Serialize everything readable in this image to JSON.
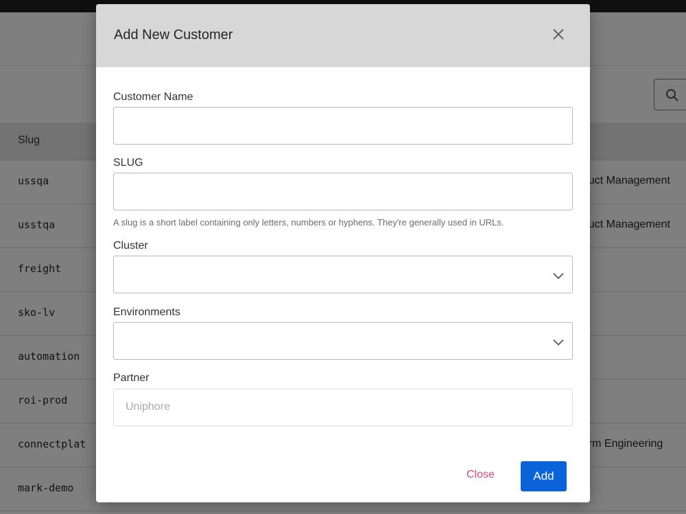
{
  "background": {
    "table_header": "Slug",
    "rows": [
      {
        "slug": "ussqa",
        "team": "oduct Management"
      },
      {
        "slug": "usstqa",
        "team": "oduct Management"
      },
      {
        "slug": "freight",
        "team": ""
      },
      {
        "slug": "sko-lv",
        "team": ""
      },
      {
        "slug": "automation",
        "team": ""
      },
      {
        "slug": "roi-prod",
        "team": ""
      },
      {
        "slug": "connectplat",
        "team": "tform Engineering"
      },
      {
        "slug": "mark-demo",
        "team": ""
      }
    ]
  },
  "modal": {
    "title": "Add New Customer",
    "customer_name_label": "Customer Name",
    "slug_label": "SLUG",
    "slug_help": "A slug is a short label containing only letters, numbers or hyphens. They're generally used in URLs.",
    "cluster_label": "Cluster",
    "environments_label": "Environments",
    "partner_label": "Partner",
    "partner_placeholder": "Uniphore",
    "close_label": "Close",
    "add_label": "Add"
  },
  "colors": {
    "primary": "#0b63d9",
    "close_link": "#e0457b",
    "header_bg": "#d7d7d7"
  }
}
